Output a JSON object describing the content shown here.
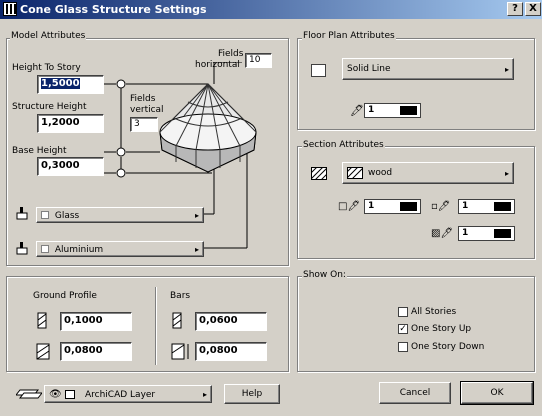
{
  "window": {
    "title": "Cone Glass Structure Settings",
    "help_btn": "?",
    "close_btn": "X"
  },
  "model_attributes": {
    "section_label": "Model Attributes",
    "height_to_story_label": "Height To Story",
    "height_to_story_value": "1,5000",
    "structure_height_label": "Structure Height",
    "structure_height_value": "1,2000",
    "base_height_label": "Base Height",
    "base_height_value": "0,3000",
    "fields_horizontal_label_1": "Fields",
    "fields_horizontal_label_2": "horizontal",
    "fields_horizontal_value": "10",
    "fields_vertical_label_1": "Fields",
    "fields_vertical_label_2": "vertical",
    "fields_vertical_value": "3",
    "glass_material": "Glass",
    "frame_material": "Aluminium"
  },
  "profiles": {
    "ground_profile_label": "Ground Profile",
    "ground_value_1": "0,1000",
    "ground_value_2": "0,0800",
    "bars_label": "Bars",
    "bars_value_1": "0,0600",
    "bars_value_2": "0,0800"
  },
  "floor_plan": {
    "section_label": "Floor Plan Attributes",
    "line_type": "Solid Line",
    "pen_value": "1"
  },
  "section_attributes": {
    "section_label": "Section Attributes",
    "fill": "wood",
    "pen_value_1": "1",
    "pen_value_2": "1",
    "pen_value_3": "1"
  },
  "show_on": {
    "section_label": "Show On:",
    "options": [
      {
        "label": "All Stories",
        "checked": false
      },
      {
        "label": "One Story Up",
        "checked": true
      },
      {
        "label": "One Story Down",
        "checked": false
      }
    ]
  },
  "footer": {
    "layer": "ArchiCAD Layer",
    "help": "Help",
    "cancel": "Cancel",
    "ok": "OK"
  }
}
